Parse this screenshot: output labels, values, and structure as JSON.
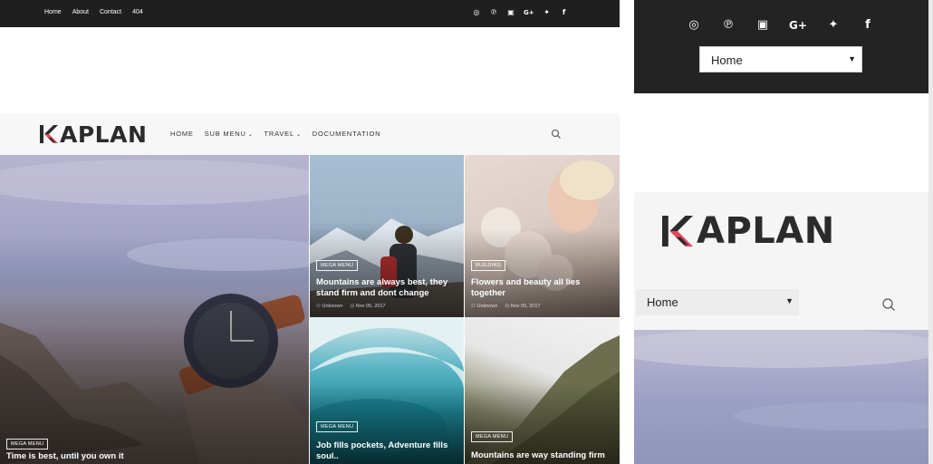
{
  "top_bar": {
    "links": [
      "Home",
      "About",
      "Contact",
      "404"
    ],
    "social_icons": [
      "instagram-icon",
      "pinterest-icon",
      "youtube-icon",
      "google-plus-icon",
      "twitter-icon",
      "facebook-icon"
    ]
  },
  "brand": {
    "logo_text": "APLAN",
    "logo_colors": {
      "accent": "#e8445a",
      "dark": "#2b2b2b"
    }
  },
  "main_nav": {
    "items": [
      {
        "label": "HOME",
        "has_dropdown": false
      },
      {
        "label": "SUB MENU",
        "has_dropdown": true
      },
      {
        "label": "TRAVEL",
        "has_dropdown": true
      },
      {
        "label": "DOCUMENTATION",
        "has_dropdown": false
      }
    ],
    "search_icon": "search-icon"
  },
  "hero_posts": [
    {
      "badge": "MEGA MENU",
      "title": "Time is best, until you own it",
      "author": "",
      "date": ""
    },
    {
      "badge": "MEGA MENU",
      "title": "Mountains are always best, they stand firm and dont change",
      "author": "Unknown",
      "date": "Nov 05, 2017"
    },
    {
      "badge": "BUILDING",
      "title": "Flowers and beauty all lies together",
      "author": "Unknown",
      "date": "Nov 05, 2017"
    },
    {
      "badge": "MEGA MENU",
      "title": "Job fills pockets, Adventure fills soul..",
      "author": "",
      "date": ""
    },
    {
      "badge": "MEGA MENU",
      "title": "Mountains are way standing firm",
      "author": "",
      "date": ""
    }
  ],
  "mobile": {
    "top_select_value": "Home",
    "nav_select_value": "Home"
  },
  "colors": {
    "top_bar_bg": "#1f1f1f",
    "nav_bg": "#f7f7f7"
  }
}
